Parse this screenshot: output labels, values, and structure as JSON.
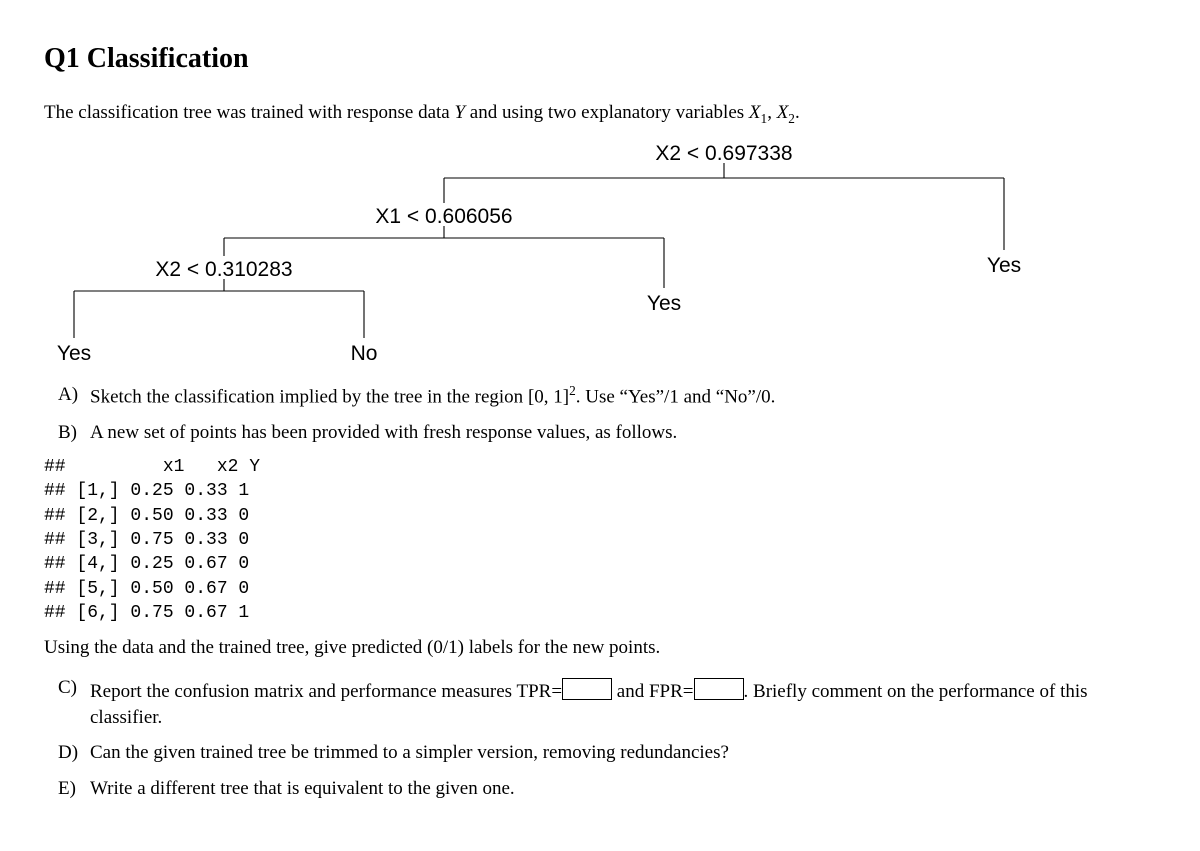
{
  "title": "Q1 Classification",
  "intro_pre": "The classification tree was trained with response data ",
  "intro_Y": "Y",
  "intro_mid": " and using two explanatory variables ",
  "intro_X1": "X",
  "intro_X1_sub": "1",
  "intro_comma": ", ",
  "intro_X2": "X",
  "intro_X2_sub": "2",
  "intro_end": ".",
  "tree": {
    "root": "X2 < 0.697338",
    "left": "X1 < 0.606056",
    "left_left": "X2 < 0.310283",
    "leaf_yes_ll": "Yes",
    "leaf_no_lr": "No",
    "leaf_yes_lr": "Yes",
    "leaf_yes_r": "Yes"
  },
  "items": {
    "A": {
      "marker": "A)",
      "pre": "Sketch the classification implied by the tree in the region ",
      "region_open": "[0, 1]",
      "region_sup": "2",
      "post": ". Use “Yes”/1 and “No”/0."
    },
    "B": {
      "marker": "B)",
      "text": "A new set of points has been provided with fresh response values, as follows."
    },
    "C": {
      "marker": "C)",
      "pre": "Report the confusion matrix and performance measures TPR=",
      "mid": " and FPR=",
      "post": ". Briefly comment on the performance of this classifier."
    },
    "D": {
      "marker": "D)",
      "text": "Can the given trained tree be trimmed to a simpler version, removing redundancies?"
    },
    "E": {
      "marker": "E)",
      "text": "Write a different tree that is equivalent to the given one."
    }
  },
  "data_block": "##         x1   x2 Y\n## [1,] 0.25 0.33 1\n## [2,] 0.50 0.33 0\n## [3,] 0.75 0.33 0\n## [4,] 0.25 0.67 0\n## [5,] 0.50 0.67 0\n## [6,] 0.75 0.67 1",
  "after_block": "Using the data and the trained tree, give predicted (0/1) labels for the new points."
}
